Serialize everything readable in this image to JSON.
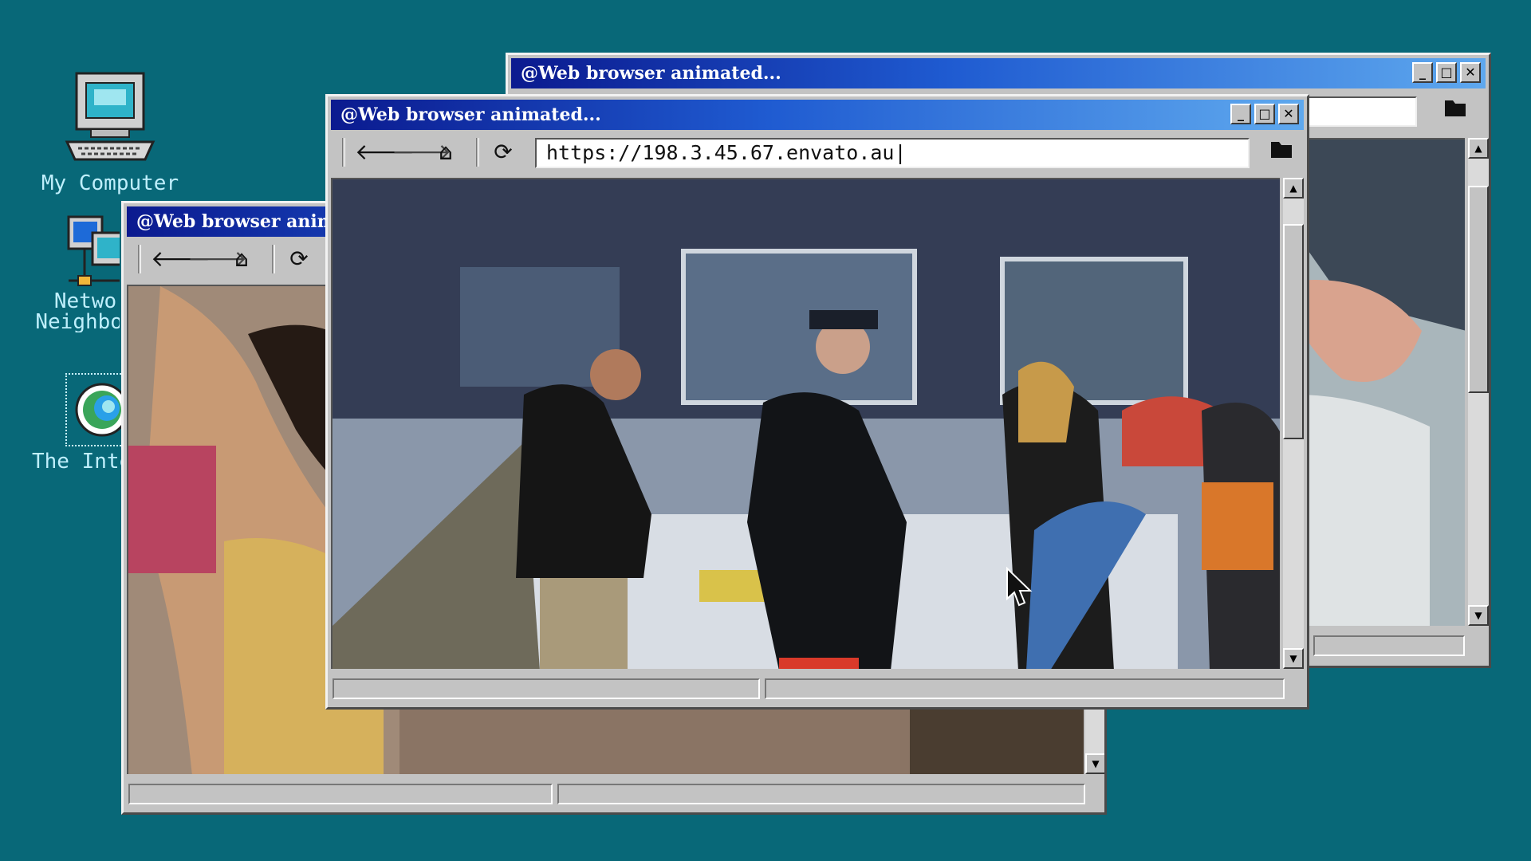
{
  "desktop": {
    "icons": [
      {
        "label": "My Computer",
        "icon": "my-computer-icon"
      },
      {
        "label": "Netwo\nNeighbou",
        "icon": "network-neighborhood-icon"
      },
      {
        "label": "The Inte",
        "icon": "internet-icon"
      }
    ]
  },
  "windows": {
    "back": {
      "title": "@Web browser animated..."
    },
    "left": {
      "title": "@Web browser anim"
    },
    "front": {
      "title": "@Web browser animated...",
      "url": "https://198.3.45.67.envato.au|"
    }
  },
  "titlebar_buttons": {
    "minimize": "_",
    "maximize": "□",
    "close": "✕"
  },
  "toolbar": {
    "back": "🡐",
    "forward": "🡒",
    "home": "⌂",
    "refresh": "⟳",
    "folder": "▬"
  },
  "colors": {
    "desktop": "#086878",
    "title_start": "#0b1a8f",
    "title_end": "#5ea8ee",
    "chrome": "#c3c3c3"
  }
}
